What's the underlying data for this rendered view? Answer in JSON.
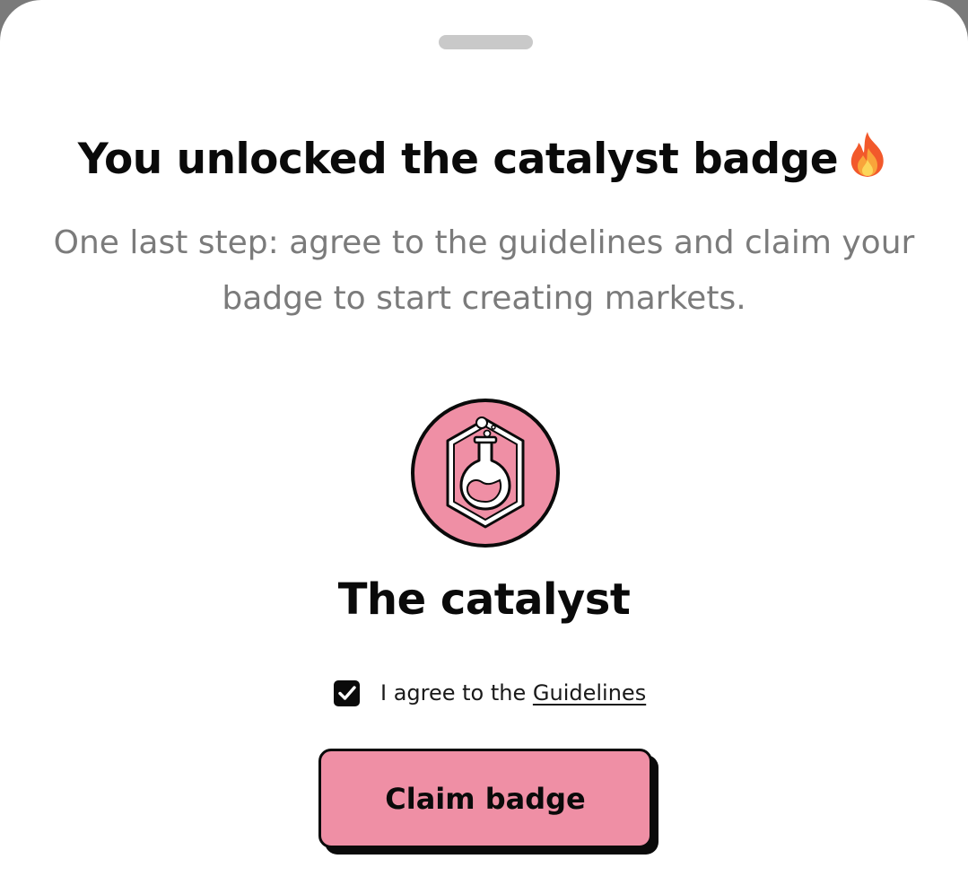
{
  "sheet": {
    "title": "You unlocked the catalyst badge",
    "subtitle": "One last step: agree to the guidelines and claim your badge to start creating markets."
  },
  "badge": {
    "name": "The catalyst",
    "icon": "flask-icon",
    "color": "#ef8fa5"
  },
  "agreement": {
    "checked": true,
    "text": "I agree to the",
    "link_label": "Guidelines"
  },
  "claim_button": {
    "label": "Claim badge"
  },
  "icons": {
    "title_emoji": "fire-icon",
    "grabber": "drag-handle",
    "checkbox": "checkmark-icon"
  }
}
